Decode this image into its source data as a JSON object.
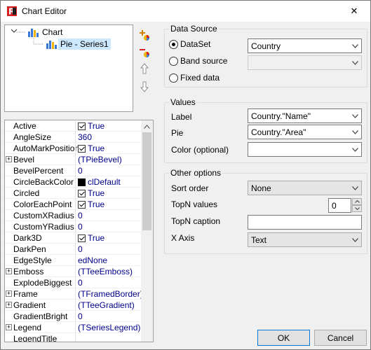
{
  "window": {
    "title": "Chart Editor",
    "close_symbol": "✕"
  },
  "tree": {
    "root_label": "Chart",
    "child_label": "Pie - Series1"
  },
  "toolbar": {
    "add_icon": "add-series-icon",
    "delete_icon": "delete-series-icon",
    "up_icon": "move-up-icon",
    "down_icon": "move-down-icon"
  },
  "inspector": {
    "properties": [
      {
        "name": "Active",
        "value": "True",
        "kind": "check",
        "expandable": false
      },
      {
        "name": "AngleSize",
        "value": "360",
        "kind": "text",
        "expandable": false
      },
      {
        "name": "AutoMarkPosition",
        "value": "True",
        "kind": "check",
        "expandable": false
      },
      {
        "name": "Bevel",
        "value": "(TPieBevel)",
        "kind": "text",
        "expandable": true
      },
      {
        "name": "BevelPercent",
        "value": "0",
        "kind": "text",
        "expandable": false
      },
      {
        "name": "CircleBackColor",
        "value": "clDefault",
        "kind": "color",
        "expandable": false
      },
      {
        "name": "Circled",
        "value": "True",
        "kind": "check",
        "expandable": false
      },
      {
        "name": "ColorEachPoint",
        "value": "True",
        "kind": "check",
        "expandable": false
      },
      {
        "name": "CustomXRadius",
        "value": "0",
        "kind": "text",
        "expandable": false
      },
      {
        "name": "CustomYRadius",
        "value": "0",
        "kind": "text",
        "expandable": false
      },
      {
        "name": "Dark3D",
        "value": "True",
        "kind": "check",
        "expandable": false
      },
      {
        "name": "DarkPen",
        "value": "0",
        "kind": "text",
        "expandable": false
      },
      {
        "name": "EdgeStyle",
        "value": "edNone",
        "kind": "text",
        "expandable": false
      },
      {
        "name": "Emboss",
        "value": "(TTeeEmboss)",
        "kind": "text",
        "expandable": true
      },
      {
        "name": "ExplodeBiggest",
        "value": "0",
        "kind": "text",
        "expandable": false
      },
      {
        "name": "Frame",
        "value": "(TFramedBorder)",
        "kind": "text",
        "expandable": true
      },
      {
        "name": "Gradient",
        "value": "(TTeeGradient)",
        "kind": "text",
        "expandable": true
      },
      {
        "name": "GradientBright",
        "value": "0",
        "kind": "text",
        "expandable": false
      },
      {
        "name": "Legend",
        "value": "(TSeriesLegend)",
        "kind": "text",
        "expandable": true
      },
      {
        "name": "LegendTitle",
        "value": "",
        "kind": "text",
        "expandable": false
      }
    ]
  },
  "data_source": {
    "title": "Data Source",
    "dataset_label": "DataSet",
    "dataset_value": "Country",
    "band_source_label": "Band source",
    "band_source_value": "",
    "fixed_data_label": "Fixed data",
    "selected": "DataSet"
  },
  "values": {
    "title": "Values",
    "label_label": "Label",
    "label_value": "Country.\"Name\"",
    "pie_label": "Pie",
    "pie_value": "Country.\"Area\"",
    "color_label": "Color (optional)",
    "color_value": ""
  },
  "other_options": {
    "title": "Other options",
    "sort_order_label": "Sort order",
    "sort_order_value": "None",
    "topn_values_label": "TopN values",
    "topn_values_value": "0",
    "topn_caption_label": "TopN caption",
    "topn_caption_value": "",
    "x_axis_label": "X Axis",
    "x_axis_value": "Text"
  },
  "buttons": {
    "ok": "OK",
    "cancel": "Cancel"
  },
  "colors": {
    "selection": "#cce8ff",
    "value_text": "#00008b",
    "logo_red": "#d42020"
  }
}
